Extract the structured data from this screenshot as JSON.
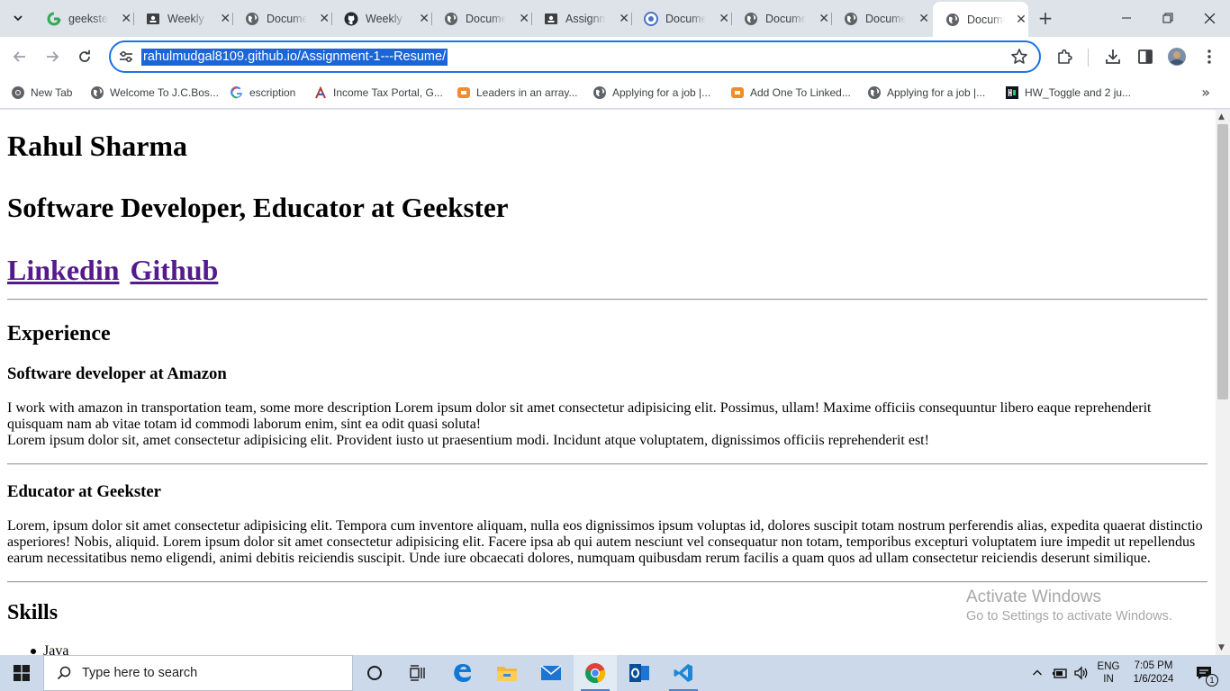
{
  "browser": {
    "tabs": [
      {
        "title": "geekster",
        "icon": "google-icon"
      },
      {
        "title": "Weekly",
        "icon": "classroom-icon"
      },
      {
        "title": "Document",
        "icon": "globe-icon"
      },
      {
        "title": "Weekly",
        "icon": "github-icon"
      },
      {
        "title": "Document",
        "icon": "globe-icon"
      },
      {
        "title": "Assignment",
        "icon": "classroom-icon"
      },
      {
        "title": "Document",
        "icon": "globe-icon"
      },
      {
        "title": "Document",
        "icon": "globe-icon"
      },
      {
        "title": "Document",
        "icon": "globe-icon"
      },
      {
        "title": "Document",
        "icon": "globe-icon"
      }
    ],
    "active_tab_index": 9,
    "url": "rahulmudgal8109.github.io/Assignment-1---Resume/",
    "bookmarks": [
      {
        "label": "New Tab",
        "icon": "chrome-icon"
      },
      {
        "label": "Welcome To J.C.Bos...",
        "icon": "globe-icon"
      },
      {
        "label": "escription",
        "icon": "google-icon"
      },
      {
        "label": "Income Tax Portal, G...",
        "icon": "income-tax-icon"
      },
      {
        "label": "Leaders in an array...",
        "icon": "codingninjas-icon"
      },
      {
        "label": "Applying for a job |...",
        "icon": "globe-icon"
      },
      {
        "label": "Add One To Linked...",
        "icon": "codingninjas-icon"
      },
      {
        "label": "Applying for a job |...",
        "icon": "globe-icon"
      },
      {
        "label": "HW_Toggle and 2 ju...",
        "icon": "hackerrank-icon"
      }
    ]
  },
  "page": {
    "name": "Rahul Sharma",
    "title": "Software Developer, Educator at Geekster",
    "links": {
      "linkedin": "Linkedin",
      "github": "Github"
    },
    "experience_heading": "Experience",
    "jobs": [
      {
        "role": "Software developer at Amazon",
        "desc_line1": "I work with amazon in transportation team, some more description Lorem ipsum dolor sit amet consectetur adipisicing elit. Possimus, ullam! Maxime officiis consequuntur libero eaque reprehenderit quisquam nam ab vitae totam id commodi laborum enim, sint ea odit quasi soluta!",
        "desc_line2": "Lorem ipsum dolor sit, amet consectetur adipisicing elit. Provident iusto ut praesentium modi. Incidunt atque voluptatem, dignissimos officiis reprehenderit est!"
      },
      {
        "role": "Educator at Geekster",
        "desc_line1": "Lorem, ipsum dolor sit amet consectetur adipisicing elit. Tempora cum inventore aliquam, nulla eos dignissimos ipsum voluptas id, dolores suscipit totam nostrum perferendis alias, expedita quaerat distinctio asperiores! Nobis, aliquid. Lorem ipsum dolor sit amet consectetur adipisicing elit. Facere ipsa ab qui autem nesciunt vel consequatur non totam, temporibus excepturi voluptatem iure impedit ut repellendus earum necessitatibus nemo eligendi, animi debitis reiciendis suscipit. Unde iure obcaecati dolores, numquam quibusdam rerum facilis a quam quos ad ullam consectetur reiciendis deserunt similique."
      }
    ],
    "skills_heading": "Skills",
    "skills": [
      "Java"
    ]
  },
  "watermark": {
    "line1": "Activate Windows",
    "line2": "Go to Settings to activate Windows."
  },
  "taskbar": {
    "search_placeholder": "Type here to search",
    "lang_line1": "ENG",
    "lang_line2": "IN",
    "time": "7:05 PM",
    "date": "1/6/2024",
    "notification_count": "1"
  },
  "colors": {
    "accent": "#1a73e8",
    "visited_link": "#551a8b",
    "taskbar": "#cbd9ea",
    "tabstrip": "#dee3ea"
  }
}
